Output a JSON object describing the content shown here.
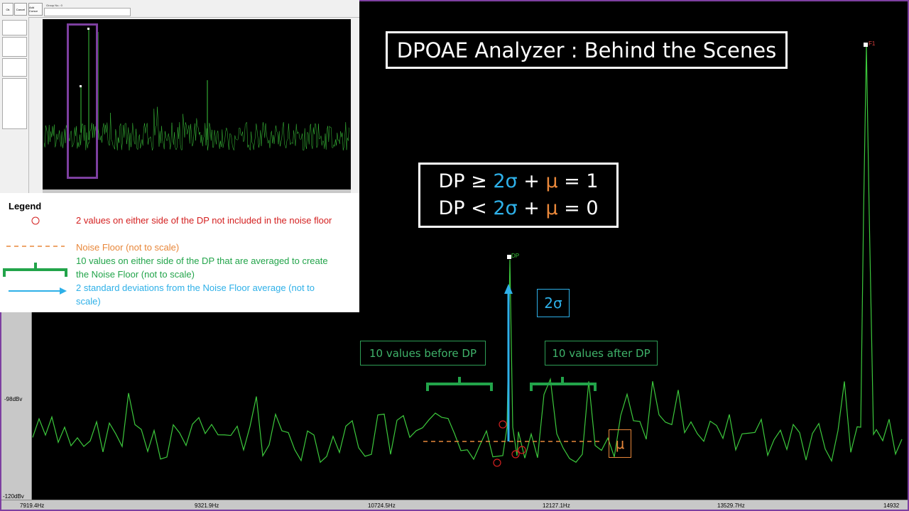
{
  "title": "DPOAE Analyzer : Behind the Scenes",
  "formula": {
    "line1": {
      "lhs": "DP ≥ ",
      "sigma": "2σ",
      "plus": " + ",
      "mu": "μ",
      "rhs": " = 1"
    },
    "line2": {
      "lhs": "DP < ",
      "sigma": "2σ",
      "plus": " + ",
      "mu": "μ",
      "rhs": " = 0"
    }
  },
  "annotations": {
    "before_label": "10 values before DP",
    "after_label": "10 values after DP",
    "sigma_label": "2σ",
    "mu_label": "μ",
    "dp_peak_label": "DP",
    "f1_peak_label": "F1"
  },
  "axis": {
    "y_ticks": [
      "-98dBv",
      "-120dBv"
    ],
    "x_ticks": [
      "7919.4Hz",
      "9321.9Hz",
      "10724.5Hz",
      "12127.1Hz",
      "13529.7Hz",
      "14932"
    ]
  },
  "legend": {
    "title": "Legend",
    "items": [
      {
        "symbol": "circle",
        "text": "2 values on either side of the DP not included in the noise floor"
      },
      {
        "symbol": "dashed-line",
        "text": "Noise Floor (not to scale)"
      },
      {
        "symbol": "bracket",
        "text": "10 values on either side of the DP that are averaged to create the Noise Floor (not to scale)"
      },
      {
        "symbol": "arrow",
        "text": "2 standard deviations from the Noise Floor average (not to scale)"
      }
    ]
  },
  "thumbnail": {
    "buttons": [
      "Ok",
      "Cancel",
      "Add Cursor"
    ],
    "group_label": "Group No.: 0",
    "peak_labels": [
      "F1",
      "F2"
    ]
  },
  "colors": {
    "spectrum": "#3cc83c",
    "noise_floor": "#e8873a",
    "sigma": "#2eb0e8",
    "circles": "#d42020",
    "bracket": "#22a44a",
    "frame": "#7d3fa0",
    "legend_red": "#d42020",
    "legend_orange": "#e8873a",
    "legend_green": "#22a44a",
    "legend_blue": "#2eb0e8"
  },
  "icons": {
    "circle": "red-circle-icon",
    "noise_floor": "dashed-line-icon",
    "bracket": "bracket-icon",
    "arrow": "arrow-icon"
  }
}
